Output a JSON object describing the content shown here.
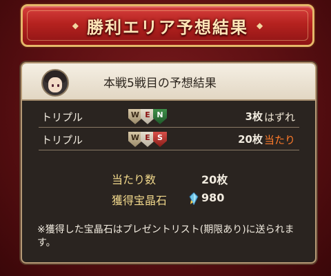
{
  "banner": {
    "title": "勝利エリア予想結果"
  },
  "panel": {
    "title": "本戦5戦目の予想結果",
    "rows": [
      {
        "label": "トリプル",
        "shields": [
          "W",
          "E",
          "N"
        ],
        "count": "3枚",
        "result": "はずれ"
      },
      {
        "label": "トリプル",
        "shields": [
          "W",
          "E",
          "S"
        ],
        "count": "20枚",
        "result": "当たり"
      }
    ],
    "summary": {
      "hits_label": "当たり数",
      "hits_value": "20枚",
      "gems_label": "獲得宝晶石",
      "gems_value": "980"
    },
    "note": "※獲得した宝晶石はプレゼントリスト(期限あり)に送られます。"
  }
}
